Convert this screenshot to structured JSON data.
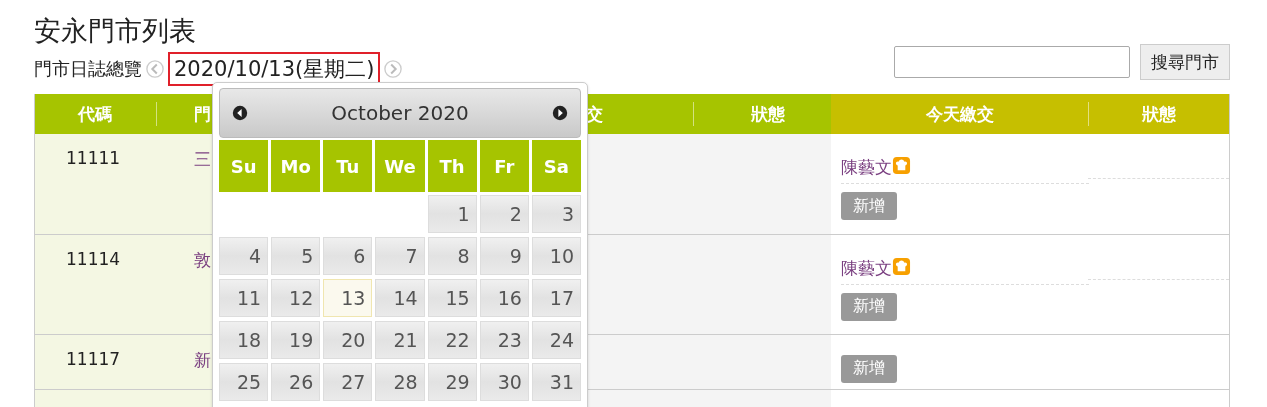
{
  "title": "安永門市列表",
  "subtitle": "門市日誌總覽",
  "date_picker": {
    "value": "2020/10/13(星期二)",
    "highlighted": true
  },
  "search": {
    "button": "搜尋門市"
  },
  "table": {
    "columns": [
      {
        "label": "代碼",
        "kind": "main"
      },
      {
        "label": "門",
        "kind": "main"
      },
      {
        "label": "交",
        "kind": "main"
      },
      {
        "label": "狀態",
        "kind": "main"
      },
      {
        "label": "今天繳交",
        "kind": "today"
      },
      {
        "label": "狀態",
        "kind": "today"
      }
    ],
    "rows": [
      {
        "code": "11111",
        "name": "三",
        "submissions": [
          {
            "name": "陳藝文"
          }
        ],
        "action": "新增"
      },
      {
        "code": "11114",
        "name": "敦",
        "submissions": [
          {
            "name": "陳藝文"
          }
        ],
        "action": "新增"
      },
      {
        "code": "11117",
        "name": "新",
        "action": "新增"
      }
    ]
  },
  "calendar": {
    "month": "October 2020",
    "weekdays": [
      "Su",
      "Mo",
      "Tu",
      "We",
      "Th",
      "Fr",
      "Sa"
    ],
    "weeks": [
      [
        {
          "kind": "blank"
        },
        {
          "kind": "blank"
        },
        {
          "kind": "blank"
        },
        {
          "kind": "blank"
        },
        {
          "kind": "day",
          "label": "1",
          "selected": false
        },
        {
          "kind": "day",
          "label": "2",
          "selected": false
        },
        {
          "kind": "day",
          "label": "3",
          "selected": false
        }
      ],
      [
        {
          "kind": "day",
          "label": "4",
          "selected": false
        },
        {
          "kind": "day",
          "label": "5",
          "selected": false
        },
        {
          "kind": "day",
          "label": "6",
          "selected": false
        },
        {
          "kind": "day",
          "label": "7",
          "selected": false
        },
        {
          "kind": "day",
          "label": "8",
          "selected": false
        },
        {
          "kind": "day",
          "label": "9",
          "selected": false
        },
        {
          "kind": "day",
          "label": "10",
          "selected": false
        }
      ],
      [
        {
          "kind": "day",
          "label": "11",
          "selected": false
        },
        {
          "kind": "day",
          "label": "12",
          "selected": false
        },
        {
          "kind": "day",
          "label": "13",
          "selected": true
        },
        {
          "kind": "day",
          "label": "14",
          "selected": false
        },
        {
          "kind": "day",
          "label": "15",
          "selected": false
        },
        {
          "kind": "day",
          "label": "16",
          "selected": false
        },
        {
          "kind": "day",
          "label": "17",
          "selected": false
        }
      ],
      [
        {
          "kind": "day",
          "label": "18",
          "selected": false
        },
        {
          "kind": "day",
          "label": "19",
          "selected": false
        },
        {
          "kind": "day",
          "label": "20",
          "selected": false
        },
        {
          "kind": "day",
          "label": "21",
          "selected": false
        },
        {
          "kind": "day",
          "label": "22",
          "selected": false
        },
        {
          "kind": "day",
          "label": "23",
          "selected": false
        },
        {
          "kind": "day",
          "label": "24",
          "selected": false
        }
      ],
      [
        {
          "kind": "day",
          "label": "25",
          "selected": false
        },
        {
          "kind": "day",
          "label": "26",
          "selected": false
        },
        {
          "kind": "day",
          "label": "27",
          "selected": false
        },
        {
          "kind": "day",
          "label": "28",
          "selected": false
        },
        {
          "kind": "day",
          "label": "29",
          "selected": false
        },
        {
          "kind": "day",
          "label": "30",
          "selected": false
        },
        {
          "kind": "day",
          "label": "31",
          "selected": false
        }
      ]
    ]
  }
}
